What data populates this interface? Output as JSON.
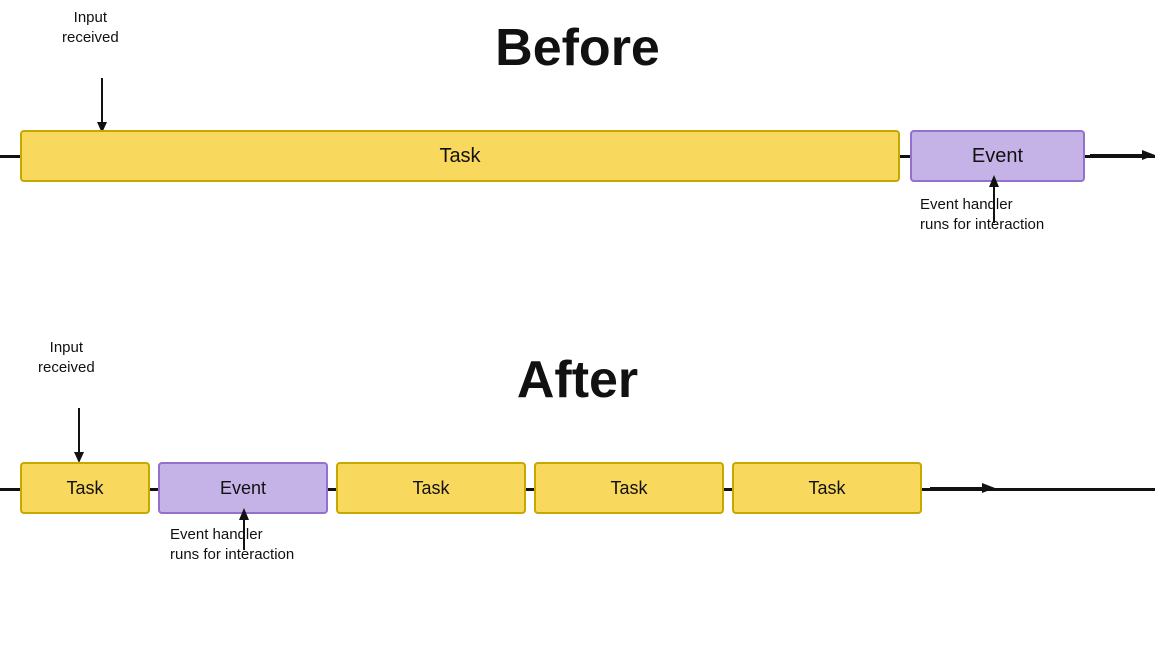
{
  "before": {
    "title": "Before",
    "input_label": "Input\nreceived",
    "task_label": "Task",
    "event_label": "Event",
    "event_handler_label": "Event handler\nruns for interaction"
  },
  "after": {
    "title": "After",
    "input_label": "Input\nreceived",
    "task1_label": "Task",
    "event_label": "Event",
    "task2_label": "Task",
    "task3_label": "Task",
    "task4_label": "Task",
    "event_handler_label": "Event handler\nruns for interaction"
  },
  "colors": {
    "task_fill": "#F9D85E",
    "task_border": "#c8a800",
    "event_fill": "#c5b3e8",
    "event_border": "#9370cc",
    "text": "#111111",
    "line": "#111111"
  }
}
